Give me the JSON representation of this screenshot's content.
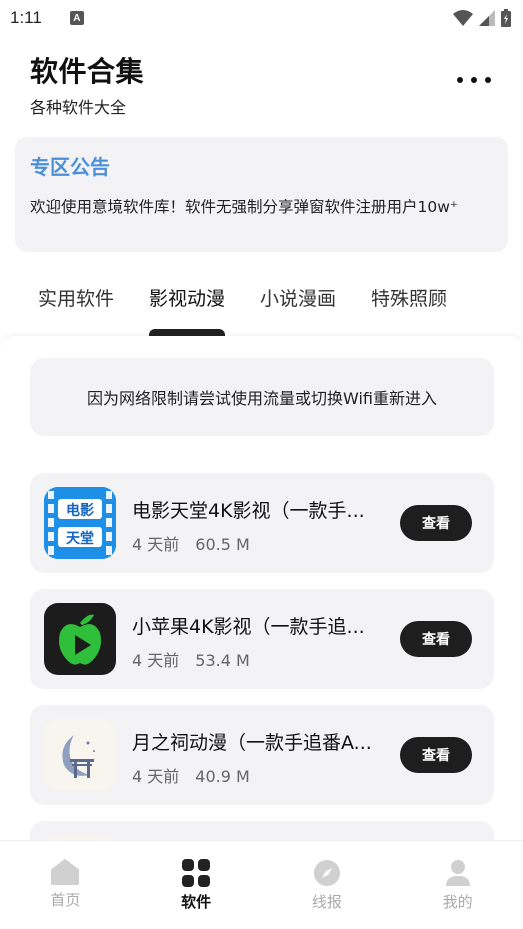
{
  "status_bar": {
    "time": "1:11",
    "notification_letter": "A"
  },
  "header": {
    "title": "软件合集",
    "subtitle": "各种软件大全"
  },
  "notice": {
    "title": "专区公告",
    "body": "欢迎使用意境软件库！软件无强制分享弹窗软件注册用户10w⁺"
  },
  "tabs": [
    {
      "label": "实用软件"
    },
    {
      "label": "影视动漫"
    },
    {
      "label": "小说漫画"
    },
    {
      "label": "特殊照顾"
    }
  ],
  "active_tab_index": 1,
  "network_notice": "因为网络限制请尝试使用流量或切换Wifi重新进入",
  "apps": [
    {
      "name": "电影天堂4K影视（一款手...",
      "time": "4 天前",
      "size": "60.5 M",
      "button": "查看",
      "icon_text_top": "电影",
      "icon_text_bottom": "天堂",
      "icon": "film-icon"
    },
    {
      "name": "小苹果4K影视（一款手追...",
      "time": "4 天前",
      "size": "53.4 M",
      "button": "查看",
      "icon": "green-apple-play-icon"
    },
    {
      "name": "月之祠动漫（一款手追番A...",
      "time": "4 天前",
      "size": "40.9 M",
      "button": "查看",
      "icon": "moon-shrine-icon"
    }
  ],
  "bottom_nav": [
    {
      "label": "首页",
      "icon": "home-icon"
    },
    {
      "label": "软件",
      "icon": "grid-icon"
    },
    {
      "label": "线报",
      "icon": "compass-icon"
    },
    {
      "label": "我的",
      "icon": "user-icon"
    }
  ],
  "colors": {
    "accent": "#4a8fd9",
    "dark_button": "#1e1e1e",
    "card_bg": "#f3f3f5",
    "apple_green": "#2fbf3a"
  }
}
